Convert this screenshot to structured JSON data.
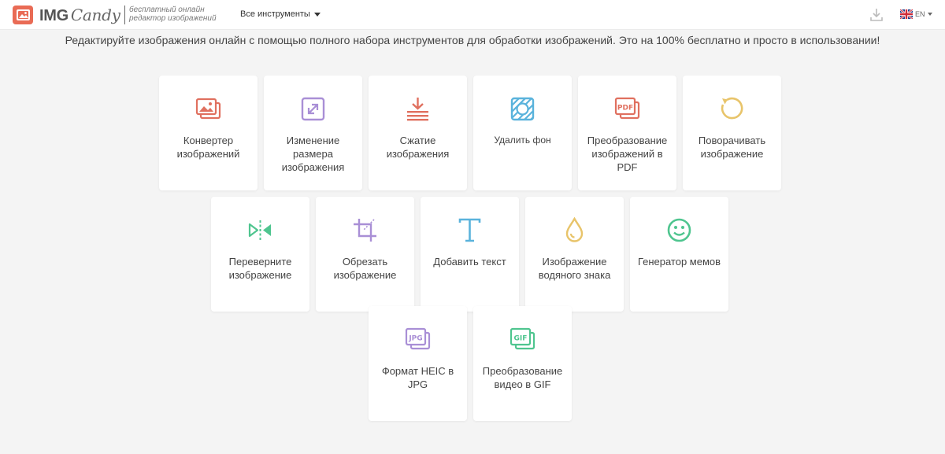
{
  "header": {
    "logo_img": "IMG",
    "logo_candy": "Candy",
    "tagline_line1": "бесплатный онлайн",
    "tagline_line2": "редактор изображений",
    "tools_menu_label": "Все инструменты",
    "language": "EN"
  },
  "intro": "Редактируйте изображения онлайн с помощью полного набора инструментов для обработки изображений. Это на 100% бесплатно и просто в использовании!",
  "tools": [
    {
      "label": "Конвертер изображений",
      "icon": "image-converter-icon",
      "color": "#e0705f"
    },
    {
      "label": "Изменение размера изображения",
      "icon": "resize-icon",
      "color": "#a98fd6"
    },
    {
      "label": "Сжатие изображения",
      "icon": "compress-icon",
      "color": "#e0705f"
    },
    {
      "label": "Удалить фон",
      "icon": "remove-background-icon",
      "color": "#5ab3dc"
    },
    {
      "label": "Преобразование изображений в PDF",
      "icon": "pdf-icon",
      "color": "#e0705f"
    },
    {
      "label": "Поворачивать изображение",
      "icon": "rotate-icon",
      "color": "#e8c46a"
    },
    {
      "label": "Переверните изображение",
      "icon": "flip-icon",
      "color": "#4fc58f"
    },
    {
      "label": "Обрезать изображение",
      "icon": "crop-icon",
      "color": "#a98fd6"
    },
    {
      "label": "Добавить текст",
      "icon": "text-icon",
      "color": "#5ab3dc"
    },
    {
      "label": "Изображение водяного знака",
      "icon": "watermark-icon",
      "color": "#e8c46a"
    },
    {
      "label": "Генератор мемов",
      "icon": "meme-icon",
      "color": "#4fc58f"
    },
    {
      "label": "Формат HEIC в JPG",
      "icon": "jpg-icon",
      "color": "#a98fd6"
    },
    {
      "label": "Преобразование видео в GIF",
      "icon": "gif-icon",
      "color": "#4fc58f"
    }
  ]
}
